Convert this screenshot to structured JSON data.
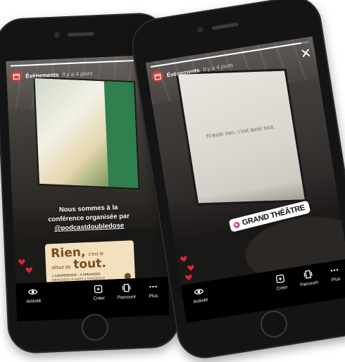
{
  "left_phone": {
    "story": {
      "account_name": "Événements",
      "time_ago": "Il y a 4 jours",
      "progress": 0.95,
      "caption_line1": "Nous sommes à la",
      "caption_line2": "conférence organisée par",
      "caption_mention": "@podcastdoubledose",
      "promo": {
        "word1": "Rien",
        "word1_suffix": ",",
        "small1": "c'est le",
        "small2": "début de",
        "word2": "tout.",
        "sub1": "1 CONFÉRENCE – 6 SPEAKERS",
        "sub2": "MERCREDI 15 MARS À BORDEAUX"
      }
    },
    "bottom_bar": {
      "activity": "Activité",
      "create": "Créer",
      "browse": "Parcourir",
      "more": "Plus"
    }
  },
  "right_phone": {
    "story": {
      "account_name": "Événements",
      "time_ago": "Il y a 4 jours",
      "progress": 0.95,
      "screen_text": "N'avoir rien, c'est avoir tout.",
      "location_tag": "GRAND THÉÂTRE"
    },
    "bottom_bar": {
      "activity": "Activité",
      "create": "Créer",
      "browse": "Parcourir",
      "more": "Plus"
    }
  },
  "colors": {
    "avatar": "#c8413b",
    "heart": "#e0243a",
    "promo_card": "#f2e0bf",
    "promo_text": "#7a4a1c"
  }
}
